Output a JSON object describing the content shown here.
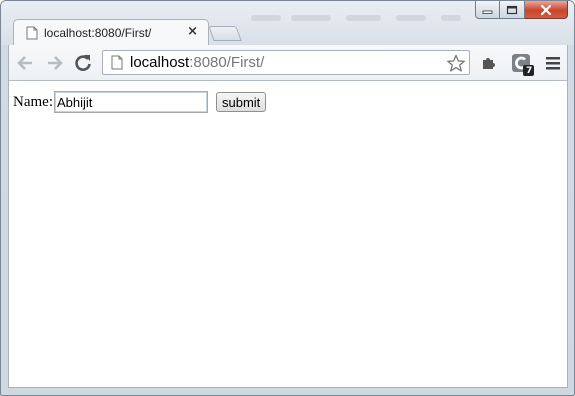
{
  "browser": {
    "tab": {
      "title": "localhost:8080/First/",
      "close_glyph": "×",
      "favicon": "page-icon"
    },
    "toolbar": {
      "back_icon": "arrow-left-icon",
      "forward_icon": "arrow-right-icon",
      "reload_icon": "reload-icon",
      "url_host": "localhost",
      "url_path": ":8080/First/",
      "bookmark_icon": "star-icon",
      "extension_icon": "puzzle-icon",
      "extension_badge_count": "7",
      "menu_icon": "hamburger-icon"
    },
    "window_controls": [
      "minimize-icon",
      "maximize-icon",
      "close-icon"
    ]
  },
  "page": {
    "form": {
      "name_label": "Name:",
      "name_value": "Abhijit",
      "submit_label": "submit"
    }
  },
  "colors": {
    "window_frame": "#d2dae4",
    "close_button": "#c7452d",
    "url_path_gray": "#777777"
  }
}
